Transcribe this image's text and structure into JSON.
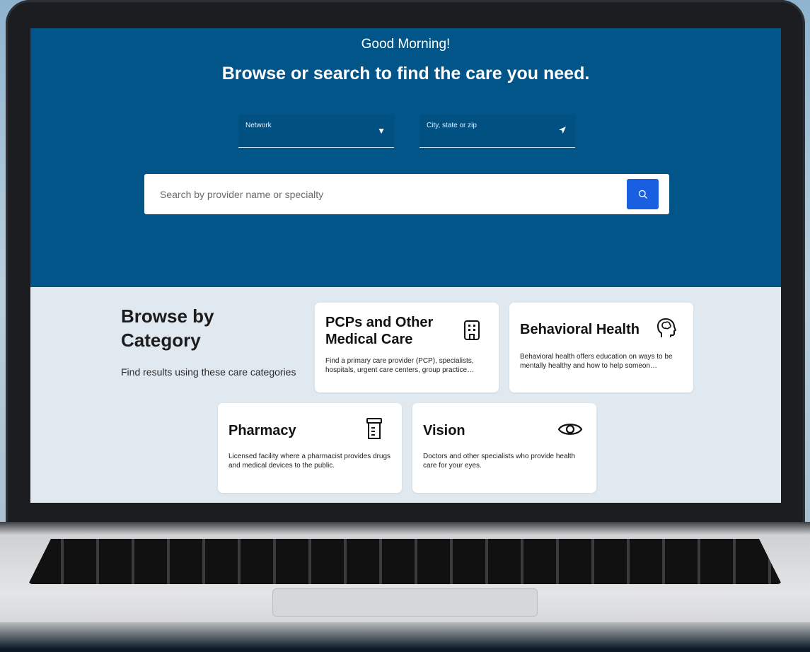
{
  "hero": {
    "greeting": "Good Morning!",
    "headline": "Browse or search to find the care you need.",
    "network_label": "Network",
    "location_label": "City, state or zip",
    "search_placeholder": "Search by provider name or specialty"
  },
  "browse": {
    "title": "Browse by Category",
    "subtitle": "Find results using these care categories"
  },
  "categories": [
    {
      "title": "PCPs and Other Medical Care",
      "description": "Find a primary care provider (PCP), specialists, hospitals, urgent care centers, group practice…",
      "icon": "building-icon"
    },
    {
      "title": "Behavioral Health",
      "description": "Behavioral health offers education on ways to be mentally healthy and how to help someon…",
      "icon": "brain-head-icon"
    },
    {
      "title": "Pharmacy",
      "description": "Licensed facility where a pharmacist provides drugs and medical devices to the public.",
      "icon": "pill-bottle-icon"
    },
    {
      "title": "Vision",
      "description": "Doctors and other specialists who provide health care for your eyes.",
      "icon": "eye-icon"
    }
  ],
  "colors": {
    "hero_bg": "#025589",
    "search_button": "#1a5fe0",
    "content_bg": "#e1e9f0"
  }
}
